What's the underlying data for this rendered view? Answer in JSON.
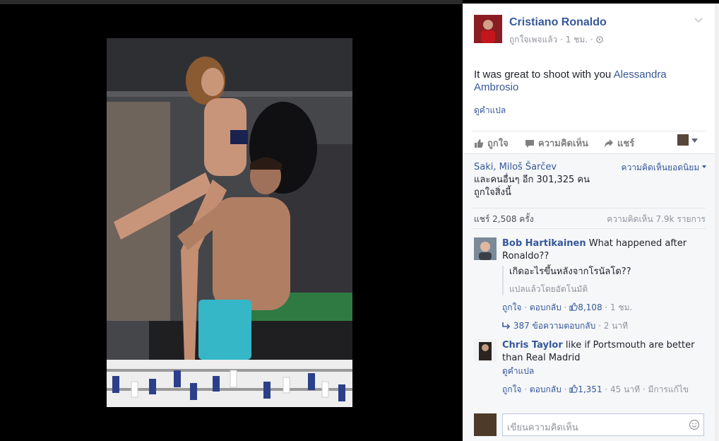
{
  "post": {
    "page_name": "Cristiano Ronaldo",
    "meta_liked": "ถูกใจเพจแล้ว",
    "meta_time": "1 ชม.",
    "text_prefix": "It was great to shoot with you ",
    "tagged_name": "Alessandra Ambrosio",
    "see_translation": "ดูคำแปล"
  },
  "actions": {
    "like": "ถูกใจ",
    "comment": "ความคิดเห็น",
    "share": "แชร์"
  },
  "social": {
    "liker_names": "Saki, Miloš Šarčev",
    "liker_rest": "และคนอื่นๆ อีก 301,325 คน",
    "liker_suffix": "ถูกใจสิ่งนี้",
    "sort_label": "ความคิดเห็นยอดนิยม",
    "shares": "แชร์ 2,508 ครั้ง",
    "comments_count": "ความคิดเห็น 7.9k รายการ"
  },
  "comments": [
    {
      "author": "Bob Hartikainen",
      "text": "What happened after Ronaldo??",
      "translation": "เกิดอะไรขึ้นหลังจากโรนัลโด??",
      "translation_note": "แปลแล้วโดยอัตโนมัติ",
      "like_label": "ถูกใจ",
      "reply_label": "ตอบกลับ",
      "likes": "8,108",
      "time": "1 ชม.",
      "replies": "387 ข้อความตอบกลับ",
      "replies_time": "2 นาที"
    },
    {
      "author": "Chris Taylor",
      "text": "like if Portsmouth are better than Real Madrid",
      "see_translation": "ดูคำแปล",
      "like_label": "ถูกใจ",
      "reply_label": "ตอบกลับ",
      "likes": "1,351",
      "time": "45 นาที",
      "edited": "มีการแก้ไข"
    }
  ],
  "compose": {
    "placeholder": "เขียนความคิดเห็น"
  },
  "colors": {
    "link": "#365899",
    "muted": "#90949c",
    "panel_bg": "#f6f7f9",
    "brand_red": "#8a1d22"
  }
}
